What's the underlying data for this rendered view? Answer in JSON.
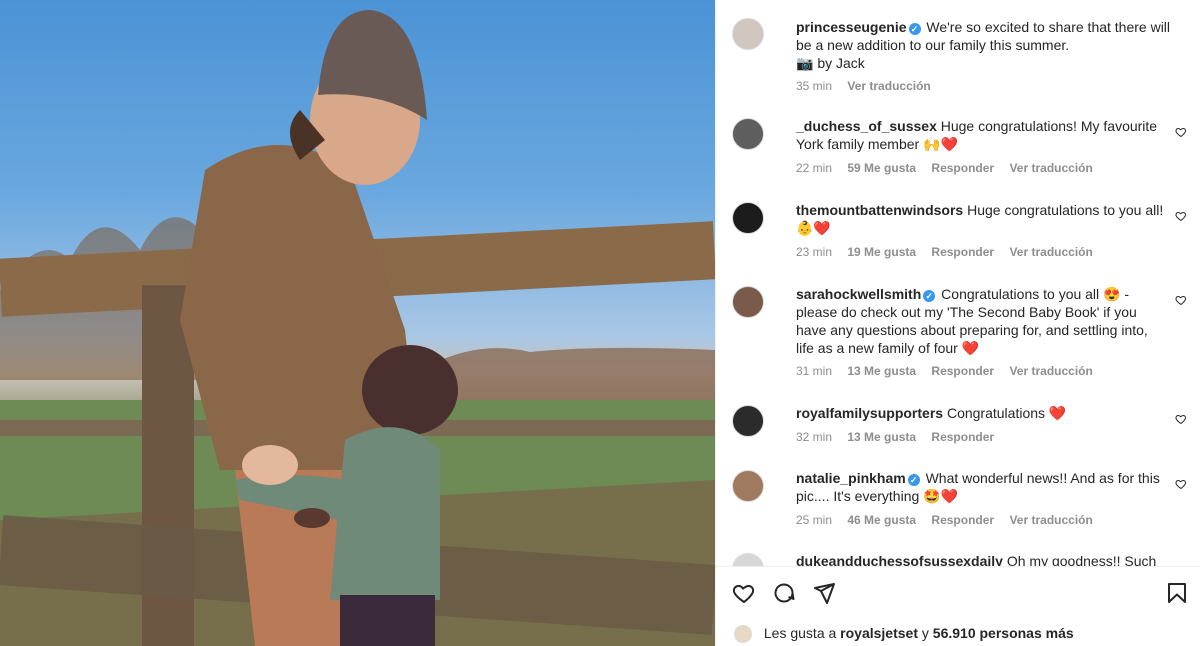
{
  "post": {
    "author": "princesseugenie",
    "caption": "We're so excited to share that there will be a new addition to our family this summer.",
    "credit": "📷 by Jack",
    "time": "35 min",
    "translate": "Ver traducción"
  },
  "comments": [
    {
      "user": "_duchess_of_sussex",
      "verified": false,
      "text": "Huge congratulations! My favourite York family member 🙌❤️",
      "time": "22 min",
      "likes": "59 Me gusta",
      "reply": "Responder",
      "translate": "Ver traducción"
    },
    {
      "user": "themountbattenwindsors",
      "verified": false,
      "text": "Huge congratulations to you all! 👶❤️",
      "time": "23 min",
      "likes": "19 Me gusta",
      "reply": "Responder",
      "translate": "Ver traducción"
    },
    {
      "user": "sarahockwellsmith",
      "verified": true,
      "text": "Congratulations to you all 😍 - please do check out my 'The Second Baby Book' if you have any questions about preparing for, and settling into, life as a new family of four ❤️",
      "time": "31 min",
      "likes": "13 Me gusta",
      "reply": "Responder",
      "translate": "Ver traducción"
    },
    {
      "user": "royalfamilysupporters",
      "verified": false,
      "text": "Congratulations ❤️",
      "time": "32 min",
      "likes": "13 Me gusta",
      "reply": "Responder",
      "translate": ""
    },
    {
      "user": "natalie_pinkham",
      "verified": true,
      "text": "What wonderful news!! And as for this pic.... It's everything 🤩❤️",
      "time": "25 min",
      "likes": "46 Me gusta",
      "reply": "Responder",
      "translate": "Ver traducción"
    },
    {
      "user": "dukeandduchessofsussexdaily",
      "verified": false,
      "text": "Oh my goodness!! Such lovely",
      "time": "",
      "likes": "",
      "reply": "",
      "translate": ""
    }
  ],
  "likes_line": {
    "prefix": "Les gusta a",
    "user": "royalsjetset",
    "middle": "y",
    "count": "56.910 personas más"
  },
  "icons": [
    "heart-icon",
    "comment-icon",
    "share-icon",
    "bookmark-icon"
  ],
  "colors": {
    "verified": "#3897f0",
    "heart": "#ed1c3a",
    "muted": "#8e8e8e"
  }
}
